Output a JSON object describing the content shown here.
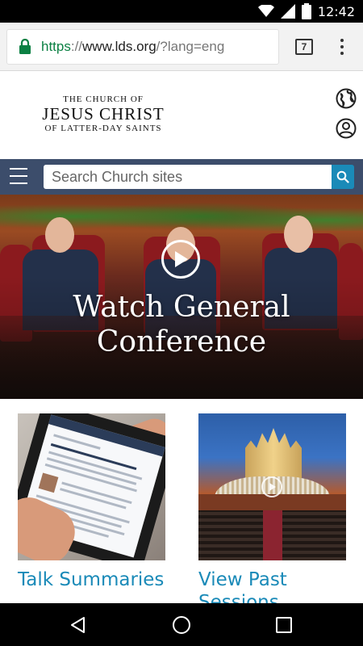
{
  "status_bar": {
    "time": "12:42",
    "icons": [
      "wifi-icon",
      "cell-signal-icon",
      "battery-icon"
    ]
  },
  "browser": {
    "url_scheme": "https",
    "url_separator": "://",
    "url_host": "www.lds.org",
    "url_rest": "/?lang=eng",
    "tab_count": "7",
    "secure": true
  },
  "site": {
    "logo": {
      "line1": "THE CHURCH OF",
      "line2": "JESUS CHRIST",
      "line3": "OF LATTER-DAY SAINTS"
    },
    "search": {
      "placeholder": "Search Church sites"
    },
    "hero": {
      "title_line1": "Watch General",
      "title_line2": "Conference"
    },
    "cards": [
      {
        "title": "Talk Summaries"
      },
      {
        "title": "View Past Sessions"
      }
    ]
  },
  "colors": {
    "brand_navy": "#3c4d6b",
    "link_blue": "#1a8ab8",
    "secure_green": "#0b8043"
  }
}
